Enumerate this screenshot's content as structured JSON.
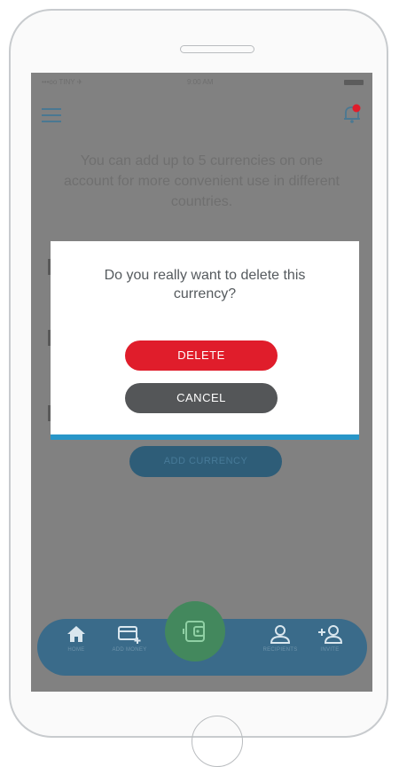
{
  "statusbar": {
    "carrier": "•••oo TINY ✈",
    "time": "9:00 AM"
  },
  "info_text": "You can add up to 5 currencies on one account for more convenient use in different countries.",
  "add_currency_label": "ADD CURRENCY",
  "dialog": {
    "message": "Do you really want to delete this currency?",
    "delete_label": "DELETE",
    "cancel_label": "CANCEL"
  },
  "tabbar": {
    "items": [
      {
        "label": "HOME",
        "icon": "home-icon"
      },
      {
        "label": "ADD MONEY",
        "icon": "add-money-icon"
      },
      {
        "label": "RECIPIENTS",
        "icon": "recipients-icon"
      },
      {
        "label": "INVITE",
        "icon": "invite-icon"
      }
    ],
    "center_icon": "wallet-icon"
  },
  "colors": {
    "accent_blue": "#2996c8",
    "delete_red": "#e01d2b",
    "cancel_gray": "#545658",
    "overlay": "#818181",
    "tabbar": "#3a6b8a",
    "wallet_green": "#43885d",
    "notification_red": "#e01d2b"
  }
}
